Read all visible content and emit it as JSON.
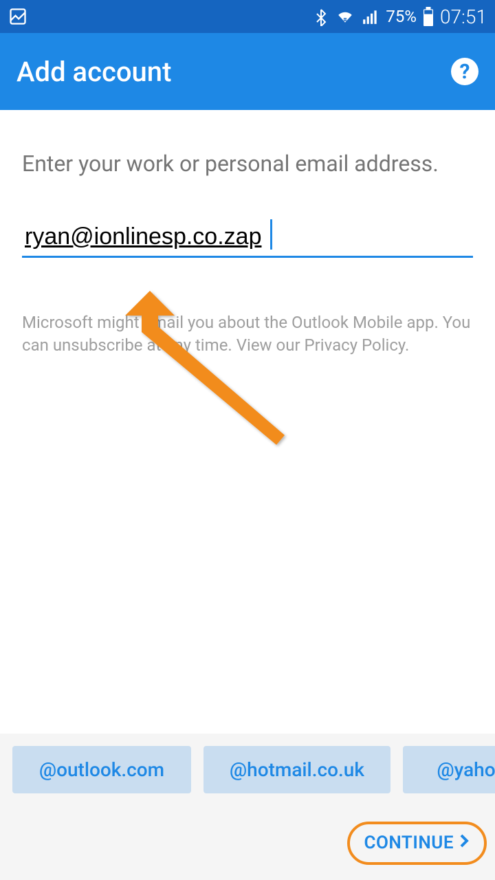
{
  "status_bar": {
    "battery_percent": "75%",
    "time": "07:51"
  },
  "app_bar": {
    "title": "Add account",
    "help_label": "?"
  },
  "content": {
    "prompt": "Enter your work or personal email address.",
    "email_value": "ryan@ionlinesp.co.zap",
    "disclaimer": "Microsoft might email you about the Outlook Mobile app. You can unsubscribe at any time. View our Privacy Policy."
  },
  "suggestions": [
    "@outlook.com",
    "@hotmail.co.uk",
    "@yahoo"
  ],
  "bottom_bar": {
    "continue_label": "CONTINUE"
  },
  "colors": {
    "primary": "#1e88e5",
    "annotation": "#f28c1e"
  }
}
